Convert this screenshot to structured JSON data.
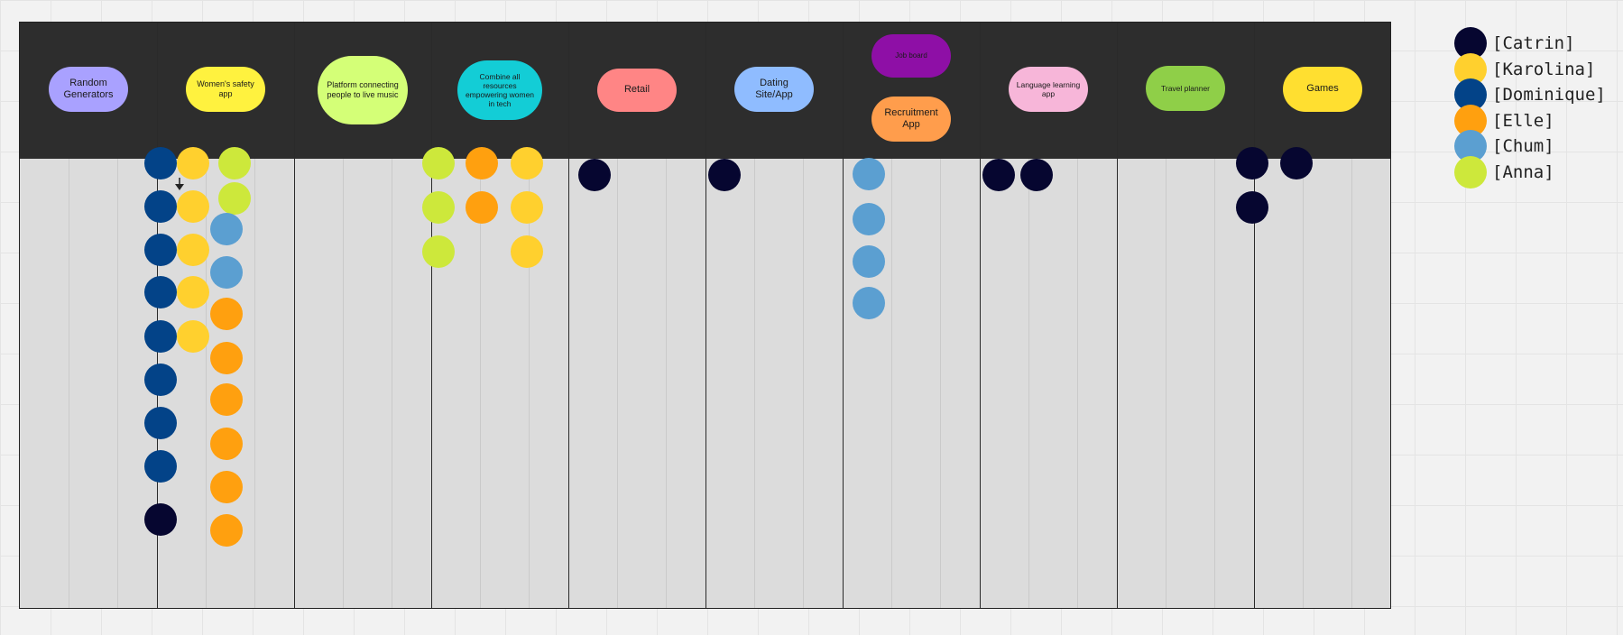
{
  "people": {
    "catrin": {
      "label": "[Catrin]",
      "color": "#060630"
    },
    "karolina": {
      "label": "[Karolina]",
      "color": "#ffd02e"
    },
    "dominique": {
      "label": "[Dominique]",
      "color": "#034388"
    },
    "elle": {
      "label": "[Elle]",
      "color": "#ffa00f"
    },
    "chum": {
      "label": "[Chum]",
      "color": "#5b9fd1"
    },
    "anna": {
      "label": "[Anna]",
      "color": "#cde83b"
    }
  },
  "legend_order": [
    "catrin",
    "karolina",
    "dominique",
    "elle",
    "chum",
    "anna"
  ],
  "columns": [
    {
      "key": "random",
      "topics": [
        {
          "text": "Random Generators",
          "color": "#a9a1ff"
        }
      ],
      "votes": {
        "dominique": 0,
        "karolina": 0,
        "anna": 0,
        "chum": 0,
        "elle": 0,
        "catrin": 0
      }
    },
    {
      "key": "womens-safety",
      "topics": [
        {
          "text": "Women's safety app",
          "color": "#fff23f"
        }
      ],
      "votes": {
        "dominique": 8,
        "karolina": 5,
        "anna": 2,
        "chum": 2,
        "elle": 6,
        "catrin": 1
      }
    },
    {
      "key": "live-music",
      "topics": [
        {
          "text": "Platform connecting people to live music",
          "color": "#d4ff77"
        }
      ],
      "votes": {
        "dominique": 0,
        "karolina": 0,
        "anna": 0,
        "chum": 0,
        "elle": 0,
        "catrin": 0
      }
    },
    {
      "key": "women-in-tech",
      "topics": [
        {
          "text": "Combine all resources empowering women in tech",
          "color": "#13cdd6"
        }
      ],
      "votes": {
        "anna": 3,
        "elle": 2,
        "karolina": 3
      }
    },
    {
      "key": "retail",
      "topics": [
        {
          "text": "Retail",
          "color": "#ff8585"
        }
      ],
      "votes": {
        "catrin": 1
      }
    },
    {
      "key": "dating",
      "topics": [
        {
          "text": "Dating Site/App",
          "color": "#8fbcff"
        }
      ],
      "votes": {
        "catrin": 1
      }
    },
    {
      "key": "jobs",
      "topics": [
        {
          "text": "Job board",
          "color": "#8e0fa6"
        },
        {
          "text": "Recruitment App",
          "color": "#ff9d4c"
        }
      ],
      "votes": {
        "chum": 4
      }
    },
    {
      "key": "language",
      "topics": [
        {
          "text": "Language learning app",
          "color": "#f7b6d9"
        }
      ],
      "votes": {
        "catrin": 2
      }
    },
    {
      "key": "travel",
      "topics": [
        {
          "text": "Travel planner",
          "color": "#8fcf48"
        }
      ],
      "votes": {
        "catrin": 0
      }
    },
    {
      "key": "games",
      "topics": [
        {
          "text": "Games",
          "color": "#ffdf30"
        }
      ],
      "votes": {
        "catrin": 3
      }
    }
  ]
}
